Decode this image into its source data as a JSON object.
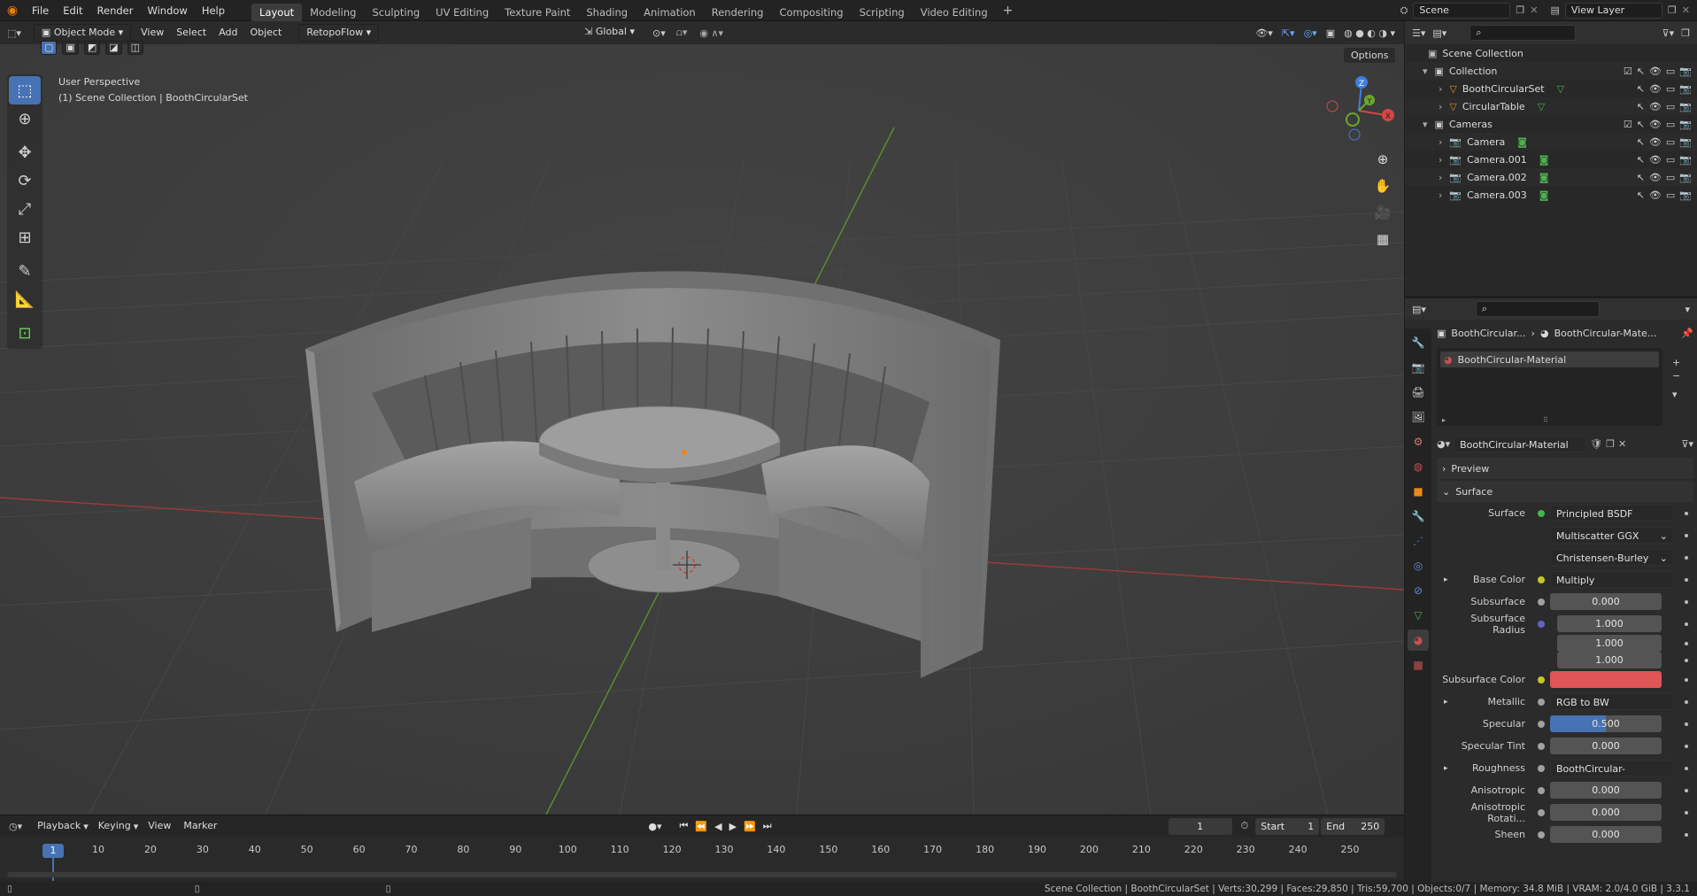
{
  "menubar": {
    "menus": [
      "File",
      "Edit",
      "Render",
      "Window",
      "Help"
    ],
    "workspaces": [
      "Layout",
      "Modeling",
      "Sculpting",
      "UV Editing",
      "Texture Paint",
      "Shading",
      "Animation",
      "Rendering",
      "Compositing",
      "Scripting",
      "Video Editing"
    ],
    "active_workspace": "Layout",
    "add_tab": "+",
    "scene": "Scene",
    "view_layer": "View Layer"
  },
  "viewport": {
    "mode": "Object Mode",
    "menus": [
      "View",
      "Select",
      "Add",
      "Object"
    ],
    "addon_menu": "RetopoFlow",
    "transform_orientation": "Global",
    "options": "Options",
    "overlay_title": "User Perspective",
    "overlay_subtitle": "(1) Scene Collection | BoothCircularSet",
    "gizmo": {
      "x": "X",
      "y": "Y",
      "z": "Z"
    }
  },
  "outliner": {
    "title": "Scene Collection",
    "rows": [
      {
        "label": "Collection",
        "indent": 1,
        "type": "collection"
      },
      {
        "label": "BoothCircularSet",
        "indent": 2,
        "type": "mesh"
      },
      {
        "label": "CircularTable",
        "indent": 2,
        "type": "mesh"
      },
      {
        "label": "Cameras",
        "indent": 1,
        "type": "collection"
      },
      {
        "label": "Camera",
        "indent": 2,
        "type": "camera"
      },
      {
        "label": "Camera.001",
        "indent": 2,
        "type": "camera"
      },
      {
        "label": "Camera.002",
        "indent": 2,
        "type": "camera"
      },
      {
        "label": "Camera.003",
        "indent": 2,
        "type": "camera"
      }
    ]
  },
  "properties": {
    "breadcrumb_object": "BoothCircular...",
    "breadcrumb_material": "BoothCircular-Mate...",
    "slot": "BoothCircular-Material",
    "material_name": "BoothCircular-Material",
    "panel_preview": "Preview",
    "panel_surface": "Surface",
    "rows": [
      {
        "label": "Surface",
        "kind": "drop",
        "value": "Principled BSDF",
        "socket": "#3fb950"
      },
      {
        "label": "",
        "kind": "select",
        "value": "Multiscatter GGX"
      },
      {
        "label": "",
        "kind": "select",
        "value": "Christensen-Burley"
      },
      {
        "label": "Base Color",
        "kind": "drop",
        "value": "Multiply",
        "socket": "#c7c729",
        "expand": true
      },
      {
        "label": "Subsurface",
        "kind": "num",
        "value": "0.000",
        "socket": "#a1a1a1"
      },
      {
        "label": "Subsurface Radius",
        "kind": "num",
        "value": "1.000",
        "socket": "#6363c7"
      },
      {
        "label": "",
        "kind": "num",
        "value": "1.000"
      },
      {
        "label": "",
        "kind": "num",
        "value": "1.000"
      },
      {
        "label": "Subsurface Color",
        "kind": "color",
        "value": "",
        "socket": "#c7c729"
      },
      {
        "label": "Metallic",
        "kind": "drop",
        "value": "RGB to BW",
        "socket": "#a1a1a1",
        "expand": true
      },
      {
        "label": "Specular",
        "kind": "slider",
        "value": "0.500",
        "fill": 0.5,
        "socket": "#a1a1a1"
      },
      {
        "label": "Specular Tint",
        "kind": "num",
        "value": "0.000",
        "socket": "#a1a1a1"
      },
      {
        "label": "Roughness",
        "kind": "drop",
        "value": "BoothCircular-Roughnes",
        "socket": "#a1a1a1",
        "expand": true
      },
      {
        "label": "Anisotropic",
        "kind": "num",
        "value": "0.000",
        "socket": "#a1a1a1"
      },
      {
        "label": "Anisotropic Rotati...",
        "kind": "num",
        "value": "0.000",
        "socket": "#a1a1a1"
      },
      {
        "label": "Sheen",
        "kind": "num",
        "value": "0.000",
        "socket": "#a1a1a1"
      }
    ],
    "colors": {
      "subsurface_color": "#e05555",
      "slider_fill": "#4772b3"
    }
  },
  "timeline": {
    "menus": [
      "Playback",
      "Keying",
      "View",
      "Marker"
    ],
    "current_frame": "1",
    "start_label": "Start",
    "start": "1",
    "end_label": "End",
    "end": "250",
    "ticks": [
      "1",
      "10",
      "20",
      "30",
      "40",
      "50",
      "60",
      "70",
      "80",
      "90",
      "100",
      "110",
      "120",
      "130",
      "140",
      "150",
      "160",
      "170",
      "180",
      "190",
      "200",
      "210",
      "220",
      "230",
      "240",
      "250"
    ]
  },
  "statusbar": {
    "text": "Scene Collection | BoothCircularSet | Verts:30,299 | Faces:29,850 | Tris:59,700 | Objects:0/7 | Memory: 34.8 MiB | VRAM: 2.0/4.0 GiB | 3.3.1"
  }
}
